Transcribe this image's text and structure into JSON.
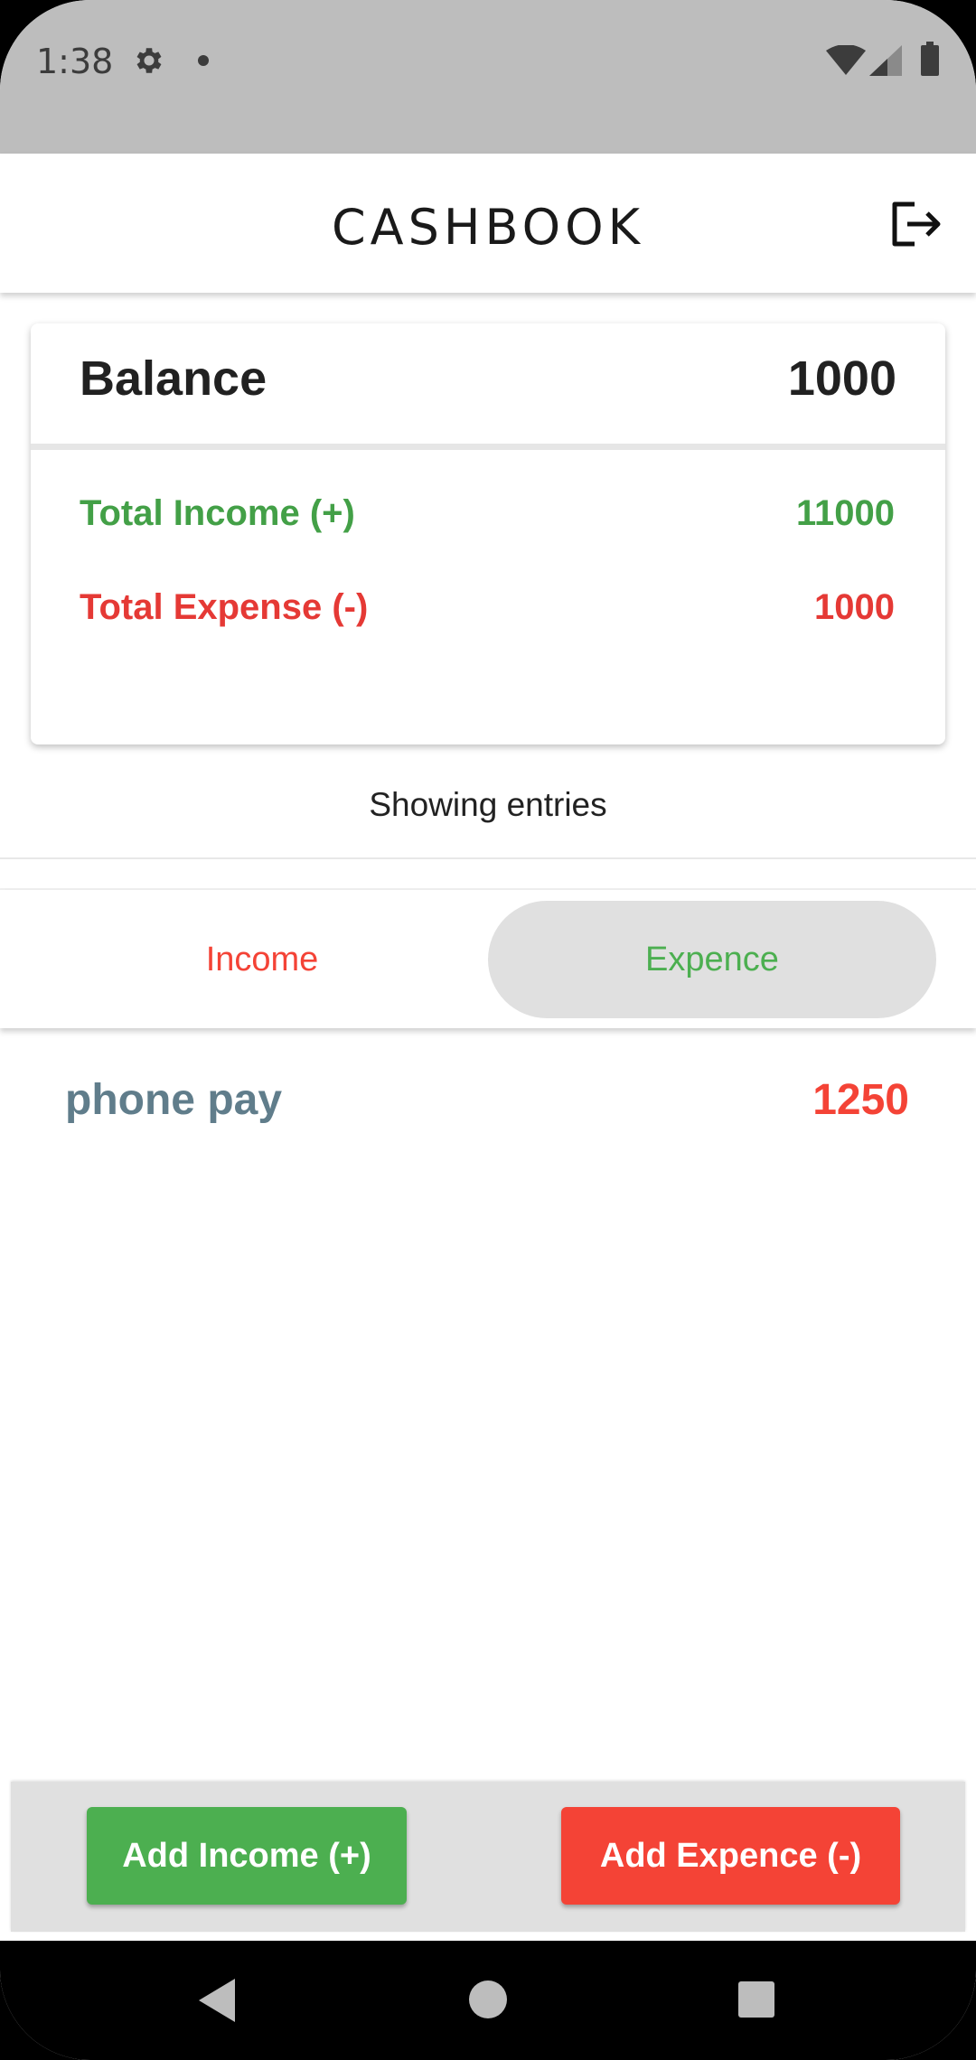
{
  "status_bar": {
    "time": "1:38",
    "icons": [
      "gear-icon",
      "notification-dot",
      "wifi-icon",
      "signal-icon",
      "battery-icon"
    ]
  },
  "app_bar": {
    "title": "CASHBOOK",
    "logout_icon": "logout-icon"
  },
  "summary": {
    "balance_label": "Balance",
    "balance_value": "1000",
    "income_label": "Total Income (+)",
    "income_value": "11000",
    "expense_label": "Total Expense (-)",
    "expense_value": "1000"
  },
  "entries_heading": "Showing entries",
  "tabs": [
    {
      "label": "Income",
      "color": "#f44336",
      "selected": false
    },
    {
      "label": "Expence",
      "color": "#4caf50",
      "selected": true
    }
  ],
  "entries": [
    {
      "name": "phone pay",
      "amount": "1250"
    }
  ],
  "actions": {
    "add_income": "Add Income (+)",
    "add_expense": "Add Expence (-)"
  },
  "colors": {
    "income": "#4caf50",
    "expense": "#f44336",
    "entry_name": "#607d8b"
  },
  "nav_bar": {
    "icons": [
      "back-icon",
      "home-icon",
      "recents-icon"
    ]
  }
}
